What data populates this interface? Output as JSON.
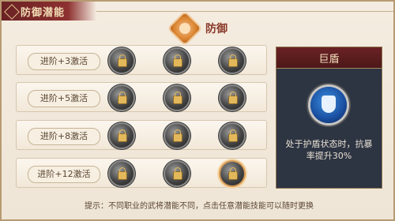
{
  "panel": {
    "title": "防御潜能"
  },
  "category": {
    "label": "防御",
    "icon": "defense-emblem-icon"
  },
  "rows": [
    {
      "label": "进阶+3激活",
      "skills": [
        "locked",
        "locked",
        "locked"
      ]
    },
    {
      "label": "进阶+5激活",
      "skills": [
        "locked",
        "locked",
        "locked"
      ]
    },
    {
      "label": "进阶+8激活",
      "skills": [
        "locked",
        "locked",
        "locked"
      ]
    },
    {
      "label": "进阶+12激活",
      "skills": [
        "locked",
        "locked",
        "selected"
      ]
    }
  ],
  "detail": {
    "name": "巨盾",
    "icon": "giant-shield-icon",
    "description": "处于护盾状态时，抗暴率提升30%"
  },
  "tip": "提示：不同职业的武将潜能不同，点击任意潜能技能可以随时更换",
  "colors": {
    "accent": "#6a2224",
    "highlight": "#d79a52",
    "shield_blue": "#1a4ea0"
  }
}
